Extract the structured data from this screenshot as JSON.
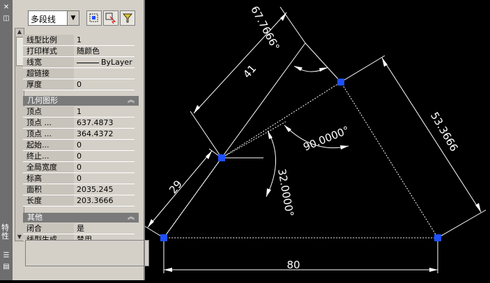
{
  "toolbar": {
    "object_type": "多段线",
    "buttons": [
      "quick-select-icon",
      "select-objects-icon",
      "toggle-pickadd-icon"
    ]
  },
  "general_rows": [
    {
      "label": "线型比例",
      "value": "1"
    },
    {
      "label": "打印样式",
      "value": "随颜色"
    },
    {
      "label": "线宽",
      "value": "ByLayer"
    },
    {
      "label": "超链接",
      "value": ""
    },
    {
      "label": "厚度",
      "value": "0"
    }
  ],
  "geometry": {
    "title": "几何图形",
    "rows": [
      {
        "label": "顶点",
        "value": "1"
      },
      {
        "label": "顶点 ...",
        "value": "637.4873"
      },
      {
        "label": "顶点 ...",
        "value": "364.4372"
      },
      {
        "label": "起始...",
        "value": "0"
      },
      {
        "label": "终止...",
        "value": "0"
      },
      {
        "label": "全局宽度",
        "value": "0"
      },
      {
        "label": "标高",
        "value": "0"
      },
      {
        "label": "面积",
        "value": "2035.245"
      },
      {
        "label": "长度",
        "value": "203.3666"
      }
    ]
  },
  "misc": {
    "title": "其他",
    "rows": [
      {
        "label": "闭合",
        "value": "是"
      },
      {
        "label": "线型生成",
        "value": "禁用"
      }
    ]
  },
  "side_label": "特性",
  "drawing": {
    "dim_top_angle": "67.7666°",
    "dim_left_top": "41",
    "dim_left": "29",
    "dim_right": "53.3666",
    "dim_bottom": "80",
    "dim_center_angle": "32.0000°",
    "dim_right_angle": "90.0000°",
    "colors": {
      "lines": "#ffffff",
      "grips": "#1e50ff",
      "background": "#000000"
    }
  }
}
